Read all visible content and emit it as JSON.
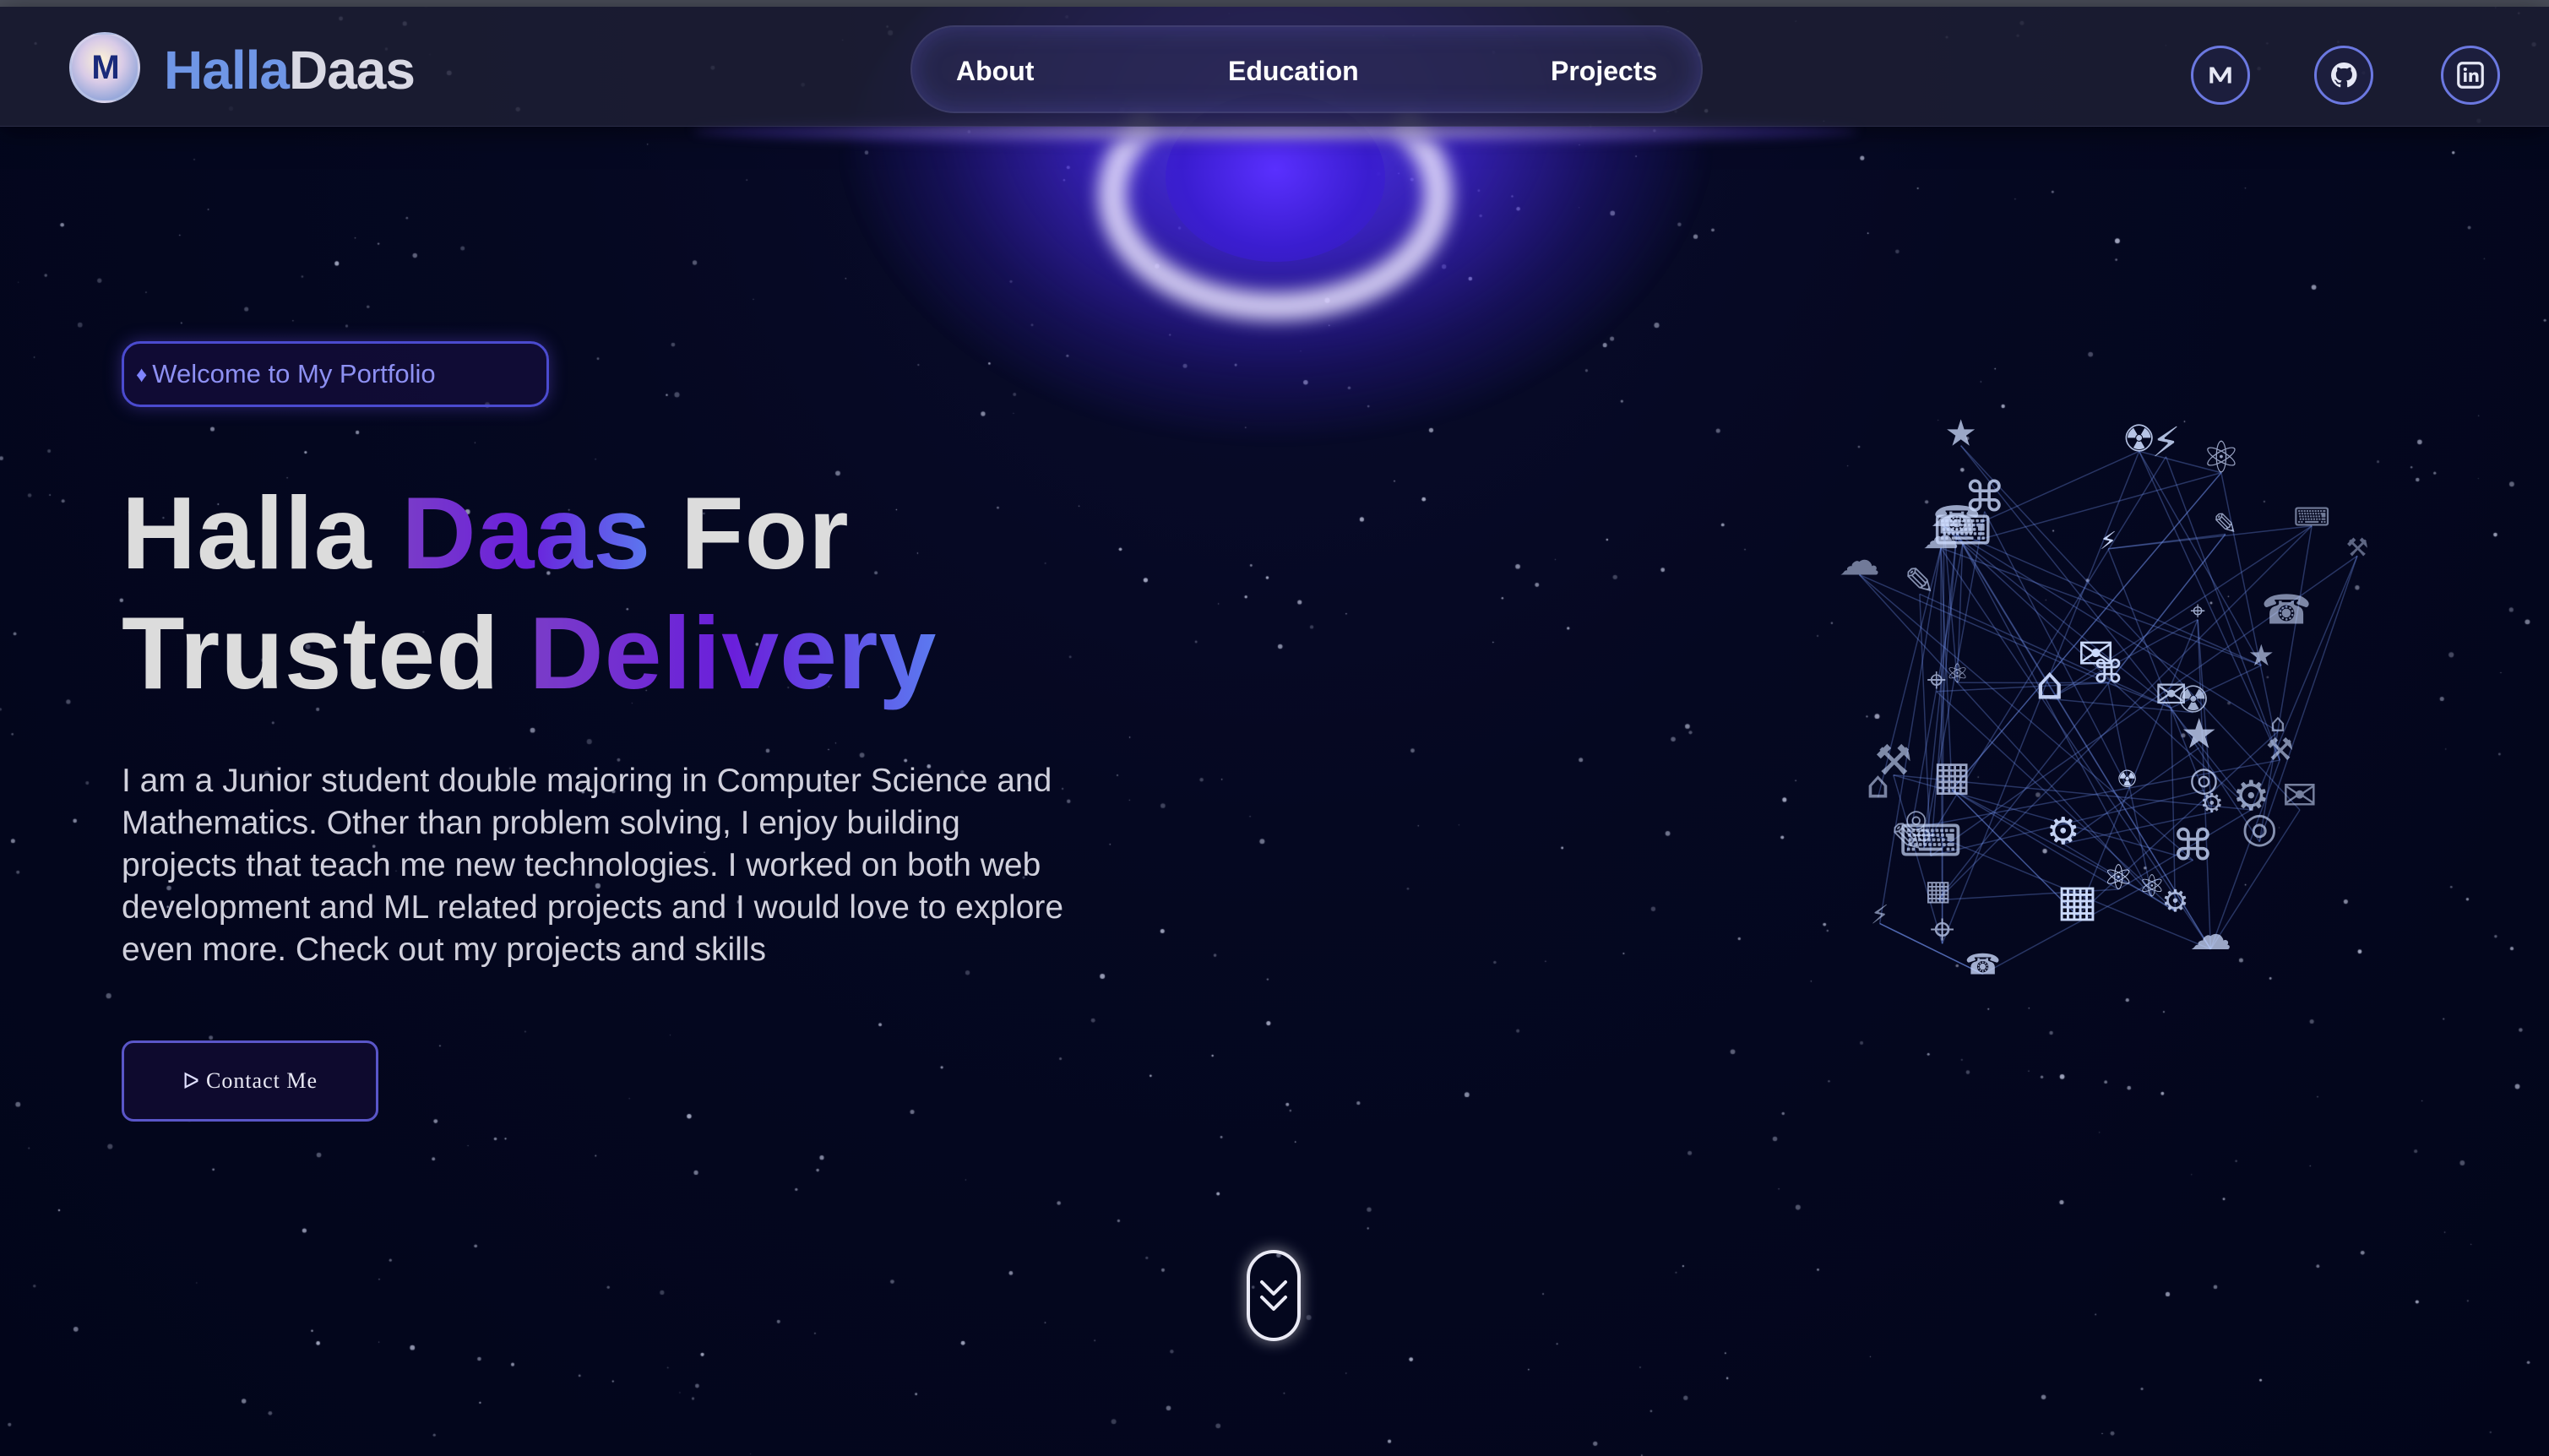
{
  "header": {
    "logo_text": "M",
    "brand_part1": "Halla",
    "brand_part2": "Daas",
    "nav": [
      "About",
      "Education",
      "Projects"
    ],
    "social": [
      "medium-icon",
      "github-icon",
      "linkedin-icon"
    ]
  },
  "hero": {
    "badge_icon": "gem-icon",
    "badge": "Welcome to My Portfolio",
    "title_line1_a": "Halla ",
    "title_line1_b": "Daas",
    "title_line1_c": " For",
    "title_line2_a": "Trusted ",
    "title_line2_b": "Delivery",
    "description": "I am a Junior student double majoring in Computer Science and Mathematics. Other than problem solving, I enjoy building projects that teach me new technologies. I worked on both web development and ML related projects and I would love to explore even more. Check out my projects and skills",
    "contact_icon": "send-icon",
    "contact_label": "Contact  Me"
  },
  "scroll_icon": "chevrons-down-icon",
  "colors": {
    "background": "#03061a",
    "accent": "#6b78e0",
    "gradient_start": "#7a3cc8",
    "gradient_end": "#5b7af0",
    "brand_blue": "#6f96e6"
  }
}
